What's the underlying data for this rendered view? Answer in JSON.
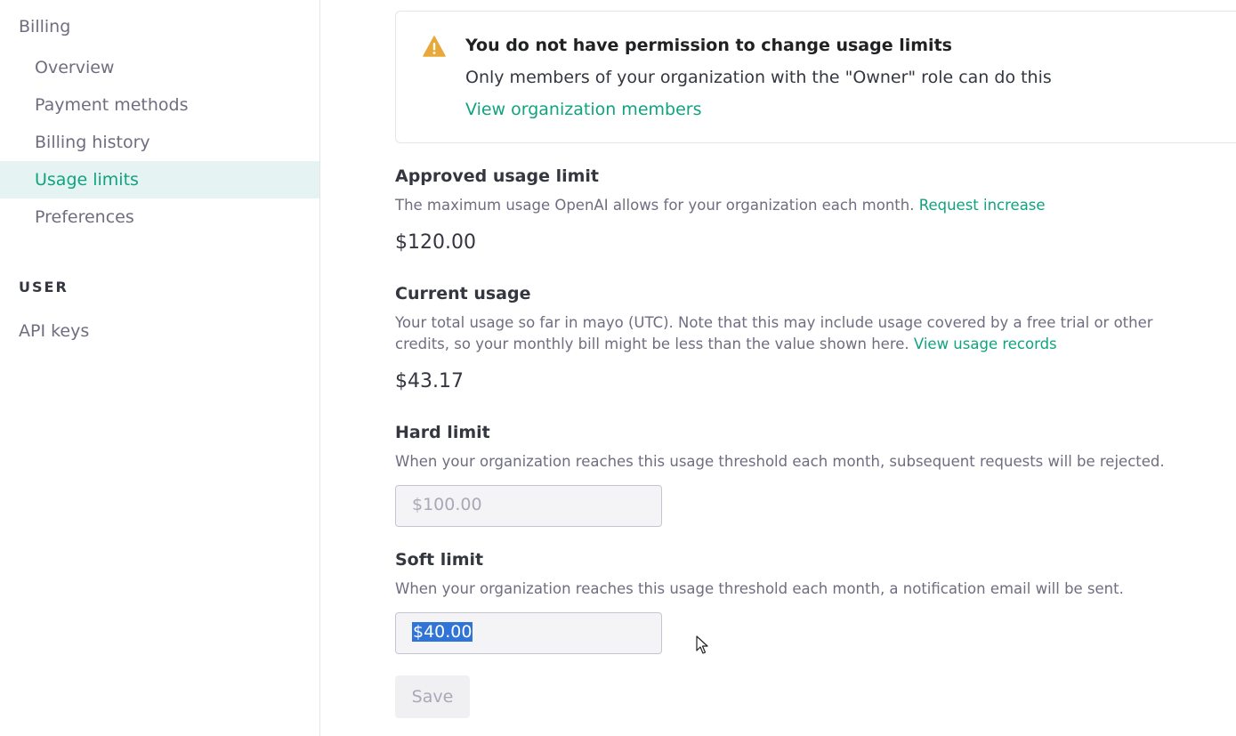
{
  "sidebar": {
    "billing_heading": "Billing",
    "items": [
      {
        "label": "Overview",
        "active": false
      },
      {
        "label": "Payment methods",
        "active": false
      },
      {
        "label": "Billing history",
        "active": false
      },
      {
        "label": "Usage limits",
        "active": true
      },
      {
        "label": "Preferences",
        "active": false
      }
    ],
    "user_section": "USER",
    "api_keys": "API keys"
  },
  "alert": {
    "icon": "warning-icon",
    "title": "You do not have permission to change usage limits",
    "body": "Only members of your organization with the \"Owner\" role can do this",
    "link": "View organization members"
  },
  "approved": {
    "title": "Approved usage limit",
    "desc": "The maximum usage OpenAI allows for your organization each month.",
    "link": "Request increase",
    "amount": "$120.00"
  },
  "current": {
    "title": "Current usage",
    "desc_line1": "Your total usage so far in mayo (UTC). Note that this may include usage covered by a free trial or other",
    "desc_line2": "credits, so your monthly bill might be less than the value shown here.",
    "link": "View usage records",
    "amount": "$43.17"
  },
  "hard_limit": {
    "title": "Hard limit",
    "desc": "When your organization reaches this usage threshold each month, subsequent requests will be rejected.",
    "value": "$100.00"
  },
  "soft_limit": {
    "title": "Soft limit",
    "desc": "When your organization reaches this usage threshold each month, a notification email will be sent.",
    "value": "$40.00"
  },
  "save_label": "Save",
  "colors": {
    "accent": "#10a37f",
    "active_bg": "#e6f3f3",
    "warning": "#e8a93a",
    "selection": "#2f74d6"
  }
}
